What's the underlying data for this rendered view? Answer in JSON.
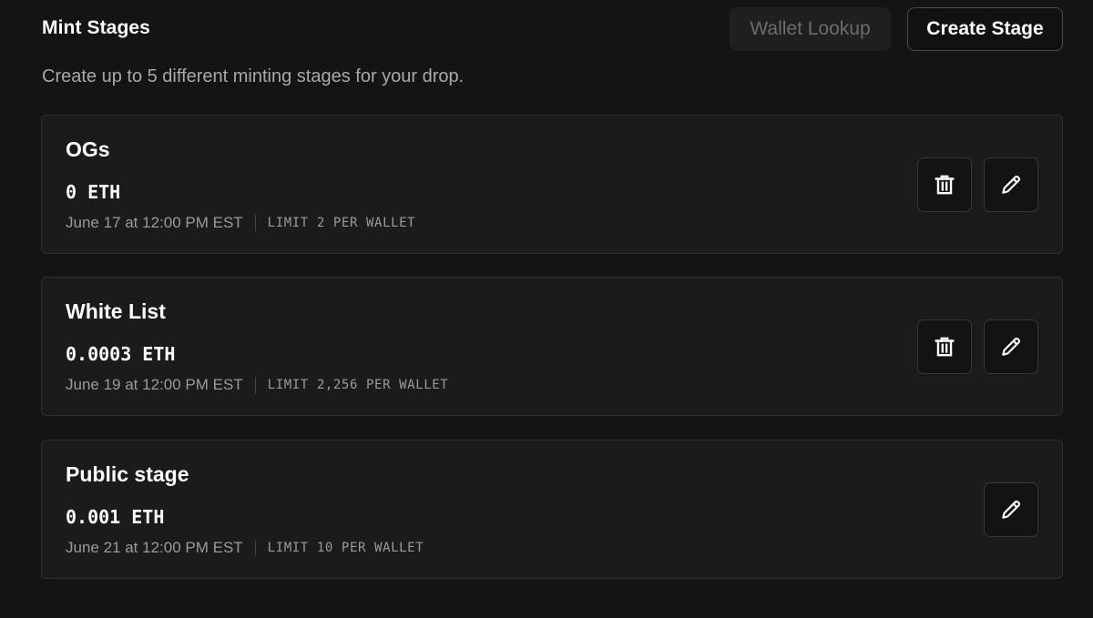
{
  "header": {
    "title": "Mint Stages",
    "wallet_lookup_label": "Wallet Lookup",
    "create_stage_label": "Create Stage"
  },
  "subtitle": "Create up to 5 different minting stages for your drop.",
  "stages": [
    {
      "name": "OGs",
      "price": "0 ETH",
      "date": "June 17 at 12:00 PM EST",
      "limit": "LIMIT 2 PER WALLET",
      "actions": [
        "trash-icon",
        "pencil-icon"
      ]
    },
    {
      "name": "White List",
      "price": "0.0003 ETH",
      "date": "June 19 at 12:00 PM EST",
      "limit": "LIMIT 2,256 PER WALLET",
      "actions": [
        "trash-icon",
        "pencil-icon"
      ]
    },
    {
      "name": "Public stage",
      "price": "0.001 ETH",
      "date": "June 21 at 12:00 PM EST",
      "limit": "LIMIT 10 PER WALLET",
      "actions": [
        "pencil-icon"
      ]
    }
  ],
  "colors": {
    "background": "#141414",
    "card": "#1b1b1b",
    "muted_text": "#9a9a9a",
    "disabled_text": "#6c6c6c"
  }
}
